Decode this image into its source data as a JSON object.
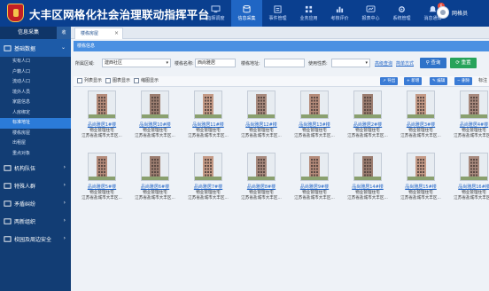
{
  "header": {
    "title": "大丰区网格化社会治理联动指挥平台",
    "nav": [
      {
        "label": "指挥调度",
        "icon": "monitor-icon"
      },
      {
        "label": "信息采集",
        "icon": "database-icon",
        "active": true
      },
      {
        "label": "事件管理",
        "icon": "list-icon"
      },
      {
        "label": "业务应用",
        "icon": "apps-icon"
      },
      {
        "label": "考核评价",
        "icon": "chart-icon"
      },
      {
        "label": "报表中心",
        "icon": "report-icon"
      },
      {
        "label": "系统管理",
        "icon": "gear-icon"
      },
      {
        "label": "消息通知",
        "icon": "bell-icon",
        "badge": "6"
      }
    ],
    "user": "网格员"
  },
  "sidebar": {
    "title": "信息采集",
    "toggle": "收",
    "groups": [
      {
        "label": "基础数据",
        "open": true,
        "items": [
          "实有人口",
          "户籍人口",
          "流动人口",
          "境外人员",
          "家庭信息",
          "人房绑定",
          "标准地址",
          "楼栋房屋",
          "出租屋",
          "重点对象"
        ],
        "active_index": 6
      },
      {
        "label": "机构队伍"
      },
      {
        "label": "特殊人群"
      },
      {
        "label": "矛盾纠纷"
      },
      {
        "label": "两新组织"
      },
      {
        "label": "校园及周边安全"
      }
    ]
  },
  "tabs": [
    {
      "label": "楼栋房屋",
      "close": "×"
    }
  ],
  "panel_title": "楼栋信息",
  "filters": {
    "grid_label": "所属区域:",
    "grid_value": "建西社区",
    "name_label": "楼栋名称:",
    "name_value": "西尚雅居",
    "addr_label": "楼栋地址:",
    "addr_value": "",
    "usage_label": "使用性质:",
    "usage_value": "",
    "advanced_link": "高级查询",
    "reset_link": "简单方式",
    "query_button": "查询",
    "reset_button": "重置"
  },
  "toolbar": {
    "view_tabs": [
      "列表显示",
      "图表显示",
      "缩图显示"
    ],
    "buttons": [
      "导出",
      "新增",
      "编辑",
      "删除"
    ],
    "extra": "标注"
  },
  "cards": [
    {
      "name": "品尚雅居1#楼",
      "org": "物业管理住宅",
      "addr": "江苏省盐城市大丰区..."
    },
    {
      "name": "品尚雅居10#楼",
      "org": "物业管理住宅",
      "addr": "江苏省盐城市大丰区..."
    },
    {
      "name": "品尚雅居11#楼",
      "org": "物业管理住宅",
      "addr": "江苏省盐城市大丰区..."
    },
    {
      "name": "品尚雅居12#楼",
      "org": "物业管理住宅",
      "addr": "江苏省盐城市大丰区..."
    },
    {
      "name": "品尚雅居13#楼",
      "org": "物业管理住宅",
      "addr": "江苏省盐城市大丰区..."
    },
    {
      "name": "品尚雅居2#楼",
      "org": "物业管理住宅",
      "addr": "江苏省盐城市大丰区..."
    },
    {
      "name": "品尚雅居3#楼",
      "org": "物业管理住宅",
      "addr": "江苏省盐城市大丰区..."
    },
    {
      "name": "品尚雅居4#楼",
      "org": "物业管理住宅",
      "addr": "江苏省盐城市大丰区..."
    },
    {
      "name": "品尚雅居5#楼",
      "org": "物业管理住宅",
      "addr": "江苏省盐城市大丰区..."
    },
    {
      "name": "品尚雅居6#楼",
      "org": "物业管理住宅",
      "addr": "江苏省盐城市大丰区..."
    },
    {
      "name": "品尚雅居7#楼",
      "org": "物业管理住宅",
      "addr": "江苏省盐城市大丰区..."
    },
    {
      "name": "品尚雅居8#楼",
      "org": "物业管理住宅",
      "addr": "江苏省盐城市大丰区..."
    },
    {
      "name": "品尚雅居9#楼",
      "org": "物业管理住宅",
      "addr": "江苏省盐城市大丰区..."
    },
    {
      "name": "品尚雅居14#楼",
      "org": "物业管理住宅",
      "addr": "江苏省盐城市大丰区..."
    },
    {
      "name": "品尚雅居15#楼",
      "org": "物业管理住宅",
      "addr": "江苏省盐城市大丰区..."
    },
    {
      "name": "品尚雅居16#楼",
      "org": "物业管理住宅",
      "addr": "江苏省盐城市大丰区..."
    }
  ],
  "colors": {
    "header_bg": "#0a3f8f",
    "sidebar_bg": "#123d74",
    "accent": "#2b7bd8",
    "query": "#2f73c9",
    "reset": "#27a35a"
  }
}
